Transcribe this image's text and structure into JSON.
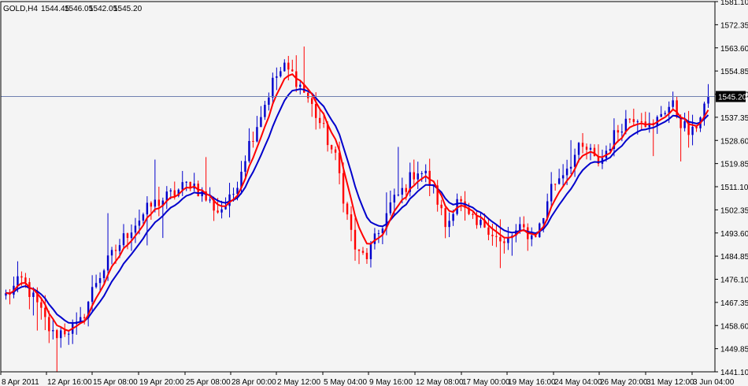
{
  "header": {
    "symbol": "GOLD,H4",
    "open": "1544.45",
    "high": "1546.05",
    "low": "1542.05",
    "close": "1545.20"
  },
  "chart_data": {
    "type": "candlestick",
    "ylim": [
      1441.1,
      1581.1
    ],
    "y_ticks": [
      "1581.10",
      "1572.35",
      "1563.60",
      "1554.85",
      "1546.10",
      "1537.35",
      "1528.60",
      "1519.85",
      "1511.10",
      "1502.35",
      "1493.60",
      "1484.85",
      "1476.10",
      "1467.35",
      "1458.60",
      "1449.85",
      "1441.10"
    ],
    "x_ticks": [
      "8 Apr 2011",
      "12 Apr 16:00",
      "15 Apr 08:00",
      "19 Apr 20:00",
      "25 Apr 08:00",
      "28 Apr 00:00",
      "2 May 12:00",
      "5 May 04:00",
      "9 May 16:00",
      "12 May 08:00",
      "17 May 00:00",
      "19 May 16:00",
      "24 May 04:00",
      "26 May 20:00",
      "31 May 12:00",
      "3 Jun 04:00"
    ],
    "bars": 180,
    "current_price": 1545.2,
    "current_price_label": "1545.20",
    "up_color": "#0000cc",
    "down_color": "#ff0000",
    "price_line_color": "#7080b0",
    "anchors": [
      [
        0,
        1470
      ],
      [
        5,
        1476
      ],
      [
        10,
        1465
      ],
      [
        14,
        1455
      ],
      [
        18,
        1457
      ],
      [
        22,
        1458
      ],
      [
        27,
        1475
      ],
      [
        33,
        1487
      ],
      [
        38,
        1496
      ],
      [
        44,
        1504
      ],
      [
        50,
        1508
      ],
      [
        56,
        1513
      ],
      [
        60,
        1507
      ],
      [
        64,
        1502
      ],
      [
        68,
        1506
      ],
      [
        73,
        1526
      ],
      [
        78,
        1542
      ],
      [
        81,
        1552
      ],
      [
        84,
        1556
      ],
      [
        87,
        1553
      ],
      [
        91,
        1545
      ],
      [
        96,
        1532
      ],
      [
        100,
        1520
      ],
      [
        103,
        1500
      ],
      [
        106,
        1485
      ],
      [
        109,
        1485
      ],
      [
        112,
        1492
      ],
      [
        116,
        1504
      ],
      [
        120,
        1510
      ],
      [
        124,
        1518
      ],
      [
        127,
        1515
      ],
      [
        130,
        1507
      ],
      [
        133,
        1495
      ],
      [
        136,
        1508
      ],
      [
        139,
        1500
      ],
      [
        142,
        1496
      ],
      [
        145,
        1497
      ],
      [
        148,
        1492
      ],
      [
        150,
        1488
      ],
      [
        153,
        1493
      ],
      [
        156,
        1495
      ],
      [
        159,
        1492
      ],
      [
        162,
        1498
      ],
      [
        164,
        1510
      ],
      [
        167,
        1515
      ],
      [
        170,
        1520
      ],
      [
        173,
        1525
      ],
      [
        176,
        1525
      ],
      [
        178,
        1520
      ],
      [
        180,
        1522
      ],
      [
        183,
        1529
      ],
      [
        186,
        1535
      ],
      [
        189,
        1538
      ],
      [
        192,
        1538
      ],
      [
        195,
        1532
      ],
      [
        198,
        1540
      ],
      [
        201,
        1542
      ],
      [
        204,
        1535
      ],
      [
        207,
        1530
      ],
      [
        210,
        1540
      ],
      [
        212,
        1545
      ]
    ],
    "ma_fast": {
      "name": "",
      "period": 5,
      "color": "#ff0000"
    },
    "ma_slow": {
      "name": "",
      "period": 10,
      "color": "#0000cc"
    }
  }
}
